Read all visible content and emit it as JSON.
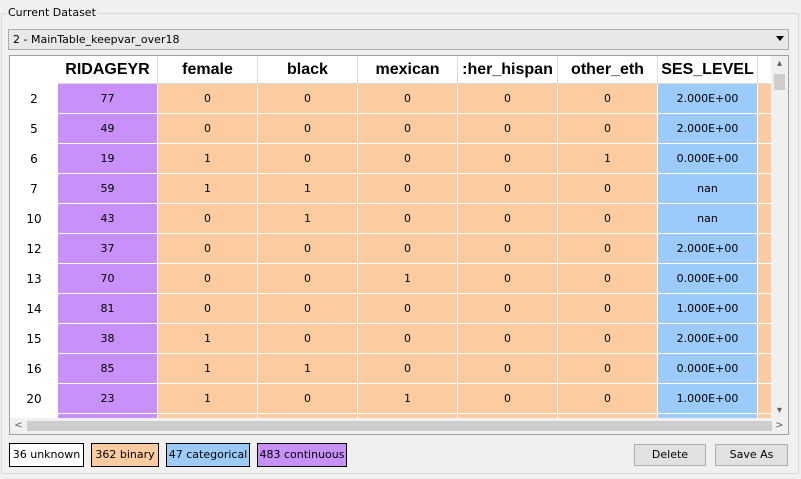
{
  "group": {
    "title": "Current Dataset"
  },
  "dataset_select": {
    "value": "2 - MainTable_keepvar_over18"
  },
  "colors": {
    "unknown": "#ffffff",
    "binary": "#fccca0",
    "categorical": "#9ccbfb",
    "continuous": "#c891f9"
  },
  "table": {
    "columns": [
      {
        "label": "RIDAGEYR",
        "type": "continuous"
      },
      {
        "label": "female",
        "type": "binary"
      },
      {
        "label": "black",
        "type": "binary"
      },
      {
        "label": "mexican",
        "type": "binary"
      },
      {
        "label": ":her_hispan",
        "type": "binary"
      },
      {
        "label": "other_eth",
        "type": "binary"
      },
      {
        "label": "SES_LEVEL",
        "type": "categorical"
      },
      {
        "label": "",
        "type": "binary"
      }
    ],
    "rows": [
      {
        "index": "2",
        "cells": [
          "77",
          "0",
          "0",
          "0",
          "0",
          "0",
          "2.000E+00",
          ""
        ]
      },
      {
        "index": "5",
        "cells": [
          "49",
          "0",
          "0",
          "0",
          "0",
          "0",
          "2.000E+00",
          ""
        ]
      },
      {
        "index": "6",
        "cells": [
          "19",
          "1",
          "0",
          "0",
          "0",
          "1",
          "0.000E+00",
          ""
        ]
      },
      {
        "index": "7",
        "cells": [
          "59",
          "1",
          "1",
          "0",
          "0",
          "0",
          "nan",
          ""
        ]
      },
      {
        "index": "10",
        "cells": [
          "43",
          "0",
          "1",
          "0",
          "0",
          "0",
          "nan",
          ""
        ]
      },
      {
        "index": "12",
        "cells": [
          "37",
          "0",
          "0",
          "0",
          "0",
          "0",
          "2.000E+00",
          ""
        ]
      },
      {
        "index": "13",
        "cells": [
          "70",
          "0",
          "0",
          "1",
          "0",
          "0",
          "0.000E+00",
          ""
        ]
      },
      {
        "index": "14",
        "cells": [
          "81",
          "0",
          "0",
          "0",
          "0",
          "0",
          "1.000E+00",
          ""
        ]
      },
      {
        "index": "15",
        "cells": [
          "38",
          "1",
          "0",
          "0",
          "0",
          "0",
          "2.000E+00",
          ""
        ]
      },
      {
        "index": "16",
        "cells": [
          "85",
          "1",
          "1",
          "0",
          "0",
          "0",
          "0.000E+00",
          ""
        ]
      },
      {
        "index": "20",
        "cells": [
          "23",
          "1",
          "0",
          "1",
          "0",
          "0",
          "1.000E+00",
          ""
        ]
      },
      {
        "index": "",
        "cells": [
          "",
          "",
          "",
          "",
          "",
          "",
          "",
          ""
        ]
      }
    ]
  },
  "legend": {
    "unknown": "36 unknown",
    "binary": "362 binary",
    "categorical": "47 categorical",
    "continuous": "483 continuous"
  },
  "buttons": {
    "delete": "Delete",
    "save_as": "Save As"
  },
  "scroll_icons": {
    "up": "▴",
    "down": "▾",
    "left": "<",
    "right": ">"
  }
}
